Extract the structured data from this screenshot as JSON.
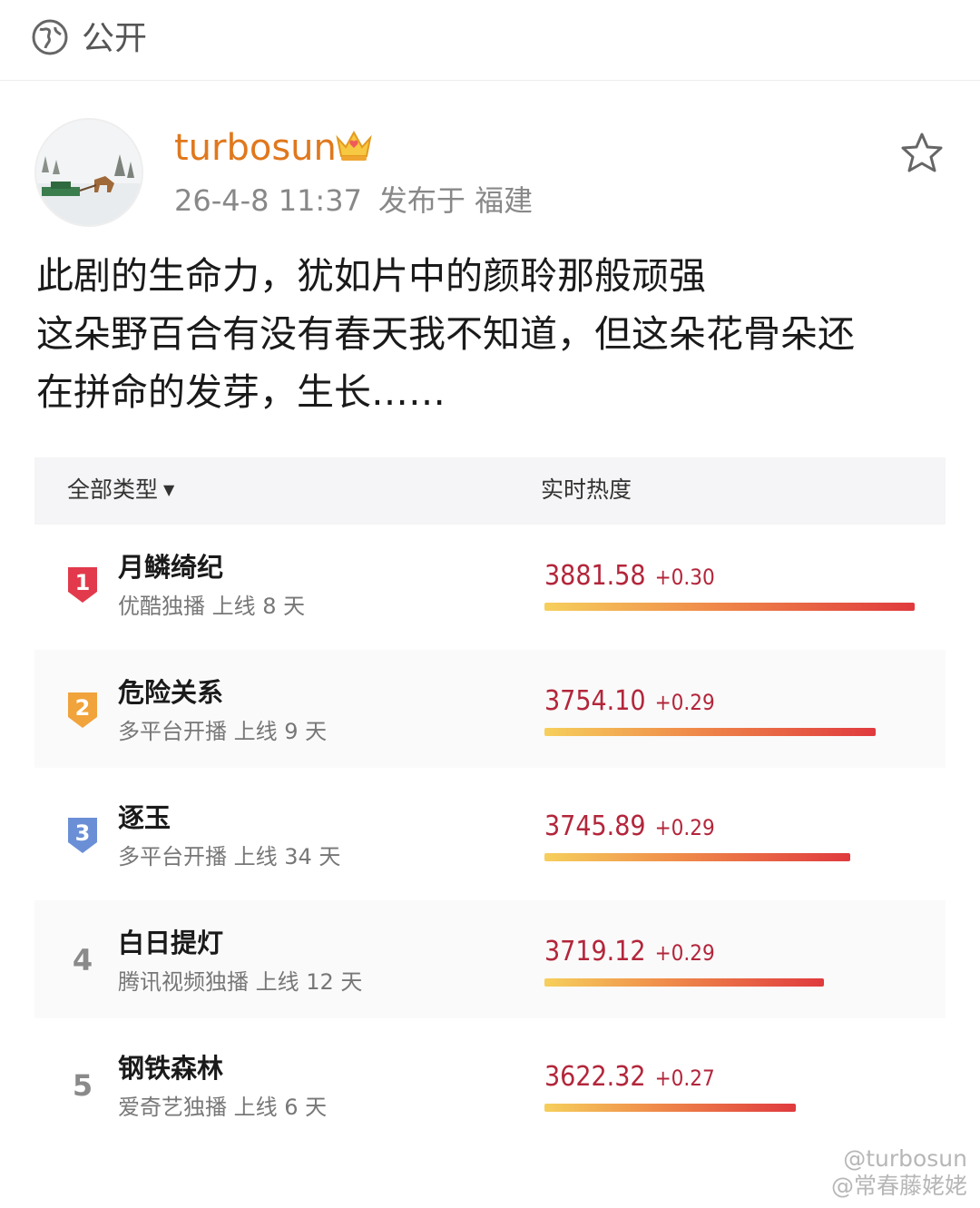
{
  "topbar": {
    "visibility_label": "公开",
    "icon": "globe-icon"
  },
  "post": {
    "username": "turbosun",
    "badge_icon": "crown-icon",
    "timestamp": "26-4-8 11:37",
    "location": "发布于 福建",
    "text": "此剧的生命力，犹如片中的颜聆那般顽强\n这朵野百合有没有春天我不知道，但这朵花骨朵还\n在拼命的发芽，生长……"
  },
  "ranking": {
    "filter_label": "全部类型",
    "heat_label": "实时热度",
    "items": [
      {
        "rank": "1",
        "title": "月鳞绮纪",
        "subtitle": "优酷独播 上线 8 天",
        "score": "3881.58",
        "delta": "+0.30",
        "heat_fraction": 1.0,
        "badge_color": "#e23a4c"
      },
      {
        "rank": "2",
        "title": "危险关系",
        "subtitle": "多平台开播 上线 9 天",
        "score": "3754.10",
        "delta": "+0.29",
        "heat_fraction": 0.895,
        "badge_color": "#f1a33c"
      },
      {
        "rank": "3",
        "title": "逐玉",
        "subtitle": "多平台开播 上线 34 天",
        "score": "3745.89",
        "delta": "+0.29",
        "heat_fraction": 0.825,
        "badge_color": "#6b8fd6"
      },
      {
        "rank": "4",
        "title": "白日提灯",
        "subtitle": "腾讯视频独播 上线 12 天",
        "score": "3719.12",
        "delta": "+0.29",
        "heat_fraction": 0.755,
        "badge_color": ""
      },
      {
        "rank": "5",
        "title": "钢铁森林",
        "subtitle": "爱奇艺独播 上线 6 天",
        "score": "3622.32",
        "delta": "+0.27",
        "heat_fraction": 0.68,
        "badge_color": ""
      }
    ]
  },
  "watermark": {
    "line1": "@turbosun",
    "line2": "@常春藤姥姥"
  }
}
